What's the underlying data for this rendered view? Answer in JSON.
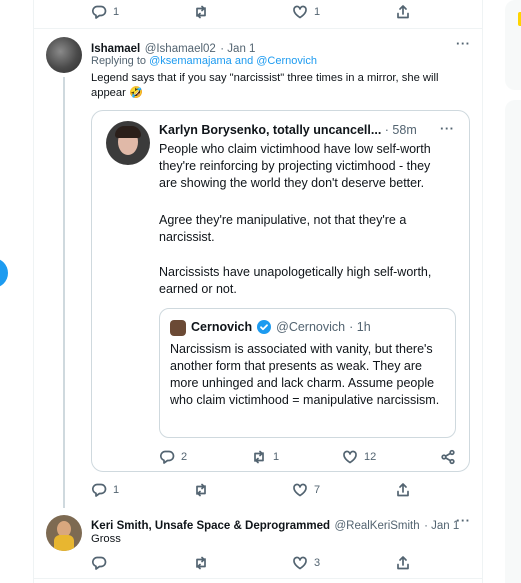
{
  "top_actions": {
    "reply_count": "1",
    "like_count": "1"
  },
  "tweet1": {
    "author_name": "Ishamael",
    "author_handle": "@Ishamael02",
    "date": "· Jan 1",
    "replying_prefix": "Replying to ",
    "replying_users": "@ksemamajama and @Cernovich",
    "text": "Legend says that if you say \"narcissist\" three times in a mirror, she will appear 🤣",
    "reply_count": "1",
    "like_count": "7"
  },
  "quote1": {
    "author_name": "Karlyn Borysenko, totally uncancell...",
    "date": "· 58m",
    "para1": "People who claim victimhood have low self-worth they're reinforcing by projecting victimhood - they are showing the world they don't deserve better.",
    "para2": "Agree they're manipulative, not that they're a narcissist.",
    "para3": "Narcissists have unapologetically high self-worth, earned or not.",
    "reply_count": "2",
    "retweet_count": "1",
    "like_count": "12"
  },
  "quote2": {
    "author_name": "Cernovich",
    "author_handle": "@Cernovich",
    "date": "· 1h",
    "text": "Narcissism is associated with vanity, but there's another form that presents as weak. They are more unhinged and lack charm. Assume people who claim victimhood = manipulative narcissism."
  },
  "tweet2": {
    "author_name": "Keri Smith, Unsafe Space & Deprogrammed",
    "author_handle": "@RealKeriSmith",
    "date": "· Jan 1",
    "text": "Gross",
    "like_count": "3"
  },
  "colors": {
    "accent": "#1d9bf0",
    "muted": "#536471",
    "border": "#cfd9de",
    "verified": "#1d9bf0"
  },
  "icons": [
    "reply-icon",
    "retweet-icon",
    "like-icon",
    "share-icon",
    "more-icon",
    "verified-icon"
  ]
}
